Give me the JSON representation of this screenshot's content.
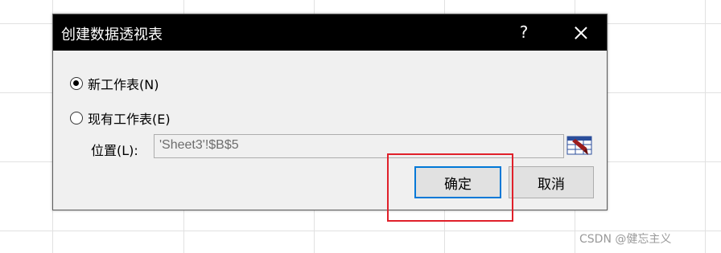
{
  "dialog": {
    "title": "创建数据透视表",
    "help_label": "?",
    "options": [
      {
        "label": "新工作表(N)",
        "checked": true
      },
      {
        "label": "现有工作表(E)",
        "checked": false
      }
    ],
    "location_label": "位置(L):",
    "location_value": "'Sheet3'!$B$5",
    "ok_label": "确定",
    "cancel_label": "取消"
  },
  "watermark": "CSDN @健忘主义",
  "colors": {
    "titlebar": "#000000",
    "dialog_bg": "#f0f0f0",
    "primary_border": "#0078d7",
    "highlight": "#e0202a"
  },
  "icons": {
    "close": "close-icon",
    "range_picker": "range-select-icon"
  }
}
